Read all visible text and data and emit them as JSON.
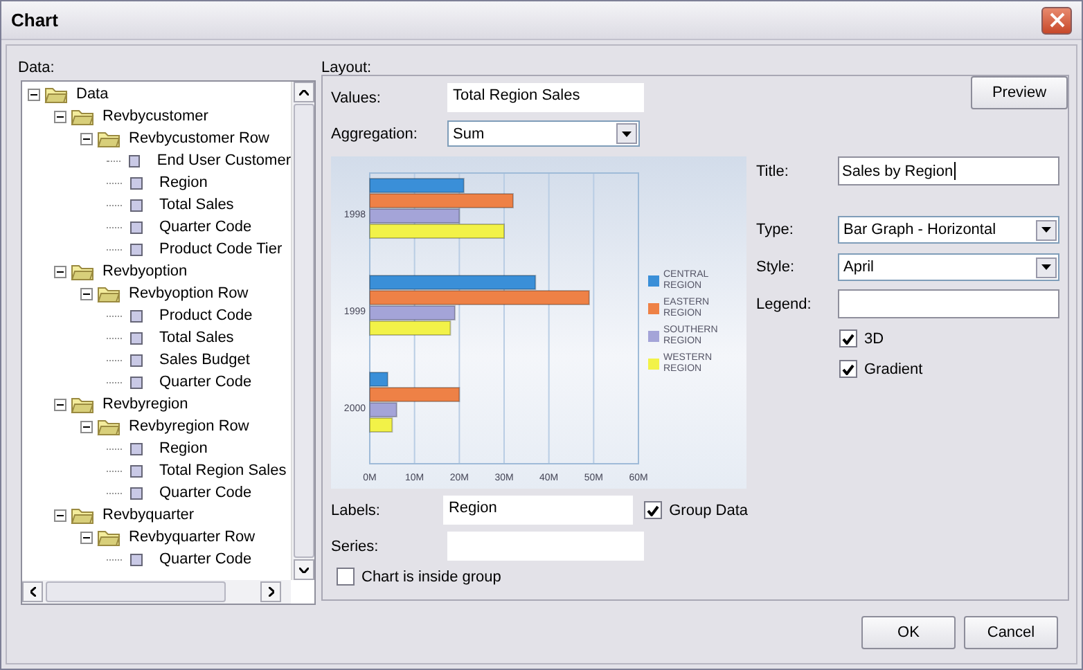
{
  "window": {
    "title": "Chart"
  },
  "data_panel": {
    "label": "Data:",
    "tree": [
      {
        "label": "Data",
        "expanded": true,
        "children": [
          {
            "label": "Revbycustomer",
            "expanded": true,
            "children": [
              {
                "label": "Revbycustomer Row",
                "expanded": true,
                "children": [
                  {
                    "label": "End User Customer"
                  },
                  {
                    "label": "Region"
                  },
                  {
                    "label": "Total Sales"
                  },
                  {
                    "label": "Quarter Code"
                  },
                  {
                    "label": "Product Code Tier"
                  }
                ]
              }
            ]
          },
          {
            "label": "Revbyoption",
            "expanded": true,
            "children": [
              {
                "label": "Revbyoption Row",
                "expanded": true,
                "children": [
                  {
                    "label": "Product Code"
                  },
                  {
                    "label": "Total Sales"
                  },
                  {
                    "label": "Sales Budget"
                  },
                  {
                    "label": "Quarter Code"
                  }
                ]
              }
            ]
          },
          {
            "label": "Revbyregion",
            "expanded": true,
            "children": [
              {
                "label": "Revbyregion Row",
                "expanded": true,
                "children": [
                  {
                    "label": "Region"
                  },
                  {
                    "label": "Total Region Sales"
                  },
                  {
                    "label": "Quarter Code"
                  }
                ]
              }
            ]
          },
          {
            "label": "Revbyquarter",
            "expanded": true,
            "children": [
              {
                "label": "Revbyquarter Row",
                "expanded": true,
                "children": [
                  {
                    "label": "Quarter Code"
                  }
                ]
              }
            ]
          }
        ]
      }
    ]
  },
  "layout": {
    "label": "Layout:",
    "preview_button": "Preview",
    "values": {
      "label": "Values:",
      "value": "Total Region Sales"
    },
    "aggregation": {
      "label": "Aggregation:",
      "value": "Sum"
    },
    "chart_data": {
      "type": "bar",
      "orientation": "horizontal",
      "categories": [
        "1998",
        "1999",
        "2000"
      ],
      "series": [
        {
          "name": "CENTRAL REGION",
          "color": "#3a8fd8",
          "values": [
            21,
            37,
            4
          ]
        },
        {
          "name": "EASTERN REGION",
          "color": "#ee8146",
          "values": [
            32,
            49,
            20
          ]
        },
        {
          "name": "SOUTHERN REGION",
          "color": "#a4a4d8",
          "values": [
            20,
            19,
            6
          ]
        },
        {
          "name": "WESTERN REGION",
          "color": "#f2f248",
          "values": [
            30,
            18,
            5
          ]
        }
      ],
      "grid": true,
      "legend": true,
      "xlim": [
        0,
        60
      ],
      "xticks": [
        {
          "value": 0,
          "label": "0M"
        },
        {
          "value": 10,
          "label": "10M"
        },
        {
          "value": 20,
          "label": "20M"
        },
        {
          "value": 30,
          "label": "30M"
        },
        {
          "value": 40,
          "label": "40M"
        },
        {
          "value": 50,
          "label": "50M"
        },
        {
          "value": 60,
          "label": "60M"
        }
      ]
    },
    "labels": {
      "label": "Labels:",
      "value": "Region"
    },
    "group_data": {
      "label": "Group Data",
      "checked": true
    },
    "series": {
      "label": "Series:"
    },
    "inside_group": {
      "label": "Chart is inside group",
      "checked": false
    },
    "title": {
      "label": "Title:",
      "value": "Sales by Region"
    },
    "type": {
      "label": "Type:",
      "value": "Bar Graph - Horizontal"
    },
    "style": {
      "label": "Style:",
      "value": "April"
    },
    "legend": {
      "label": "Legend:"
    },
    "options": [
      {
        "label": "3D",
        "checked": true
      },
      {
        "label": "Gradient",
        "checked": true
      }
    ]
  },
  "buttons": [
    "OK",
    "Cancel"
  ]
}
